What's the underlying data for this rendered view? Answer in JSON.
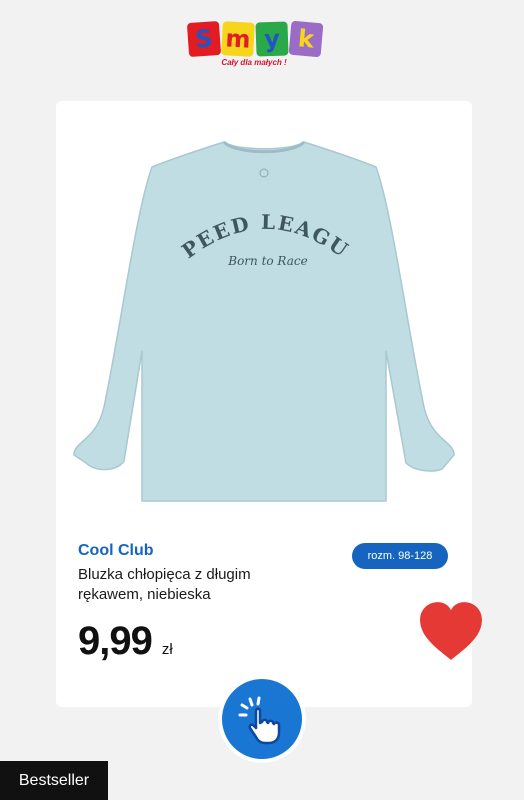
{
  "logo": {
    "letters": [
      "S",
      "m",
      "y",
      "k"
    ],
    "tile_colors": [
      "#e31b23",
      "#f7d51d",
      "#2aa84a",
      "#9b6cc5"
    ],
    "letter_colors": [
      "#2255c4",
      "#e31b23",
      "#2255c4",
      "#f7d51d"
    ],
    "slogan": "Cały dla małych !"
  },
  "product": {
    "image_icon": "long-sleeve-tshirt-image",
    "print_line1": "SPEED LEAGUE",
    "print_line2": "Born to Race",
    "shirt_color": "#bfdde3",
    "brand": "Cool Club",
    "size_badge": "rozm. 98-128",
    "title": "Bluzka chłopięca z długim rękawem, niebieska",
    "price": "9,99",
    "currency": "zł"
  },
  "actions": {
    "favorite_icon": "heart-icon",
    "favorite_color": "#e53935",
    "tap_icon": "tap-hand-icon",
    "tap_color": "#1976d2"
  },
  "badge": {
    "bestseller": "Bestseller"
  }
}
